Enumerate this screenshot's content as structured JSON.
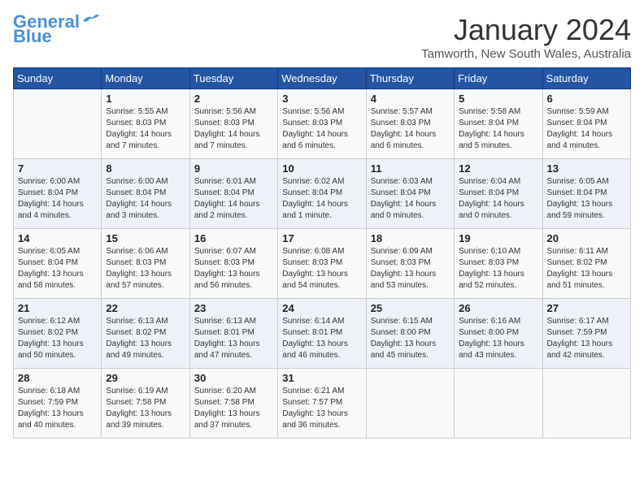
{
  "logo": {
    "line1": "General",
    "line2": "Blue"
  },
  "title": "January 2024",
  "subtitle": "Tamworth, New South Wales, Australia",
  "weekdays": [
    "Sunday",
    "Monday",
    "Tuesday",
    "Wednesday",
    "Thursday",
    "Friday",
    "Saturday"
  ],
  "weeks": [
    [
      {
        "day": "",
        "info": ""
      },
      {
        "day": "1",
        "info": "Sunrise: 5:55 AM\nSunset: 8:03 PM\nDaylight: 14 hours\nand 7 minutes."
      },
      {
        "day": "2",
        "info": "Sunrise: 5:56 AM\nSunset: 8:03 PM\nDaylight: 14 hours\nand 7 minutes."
      },
      {
        "day": "3",
        "info": "Sunrise: 5:56 AM\nSunset: 8:03 PM\nDaylight: 14 hours\nand 6 minutes."
      },
      {
        "day": "4",
        "info": "Sunrise: 5:57 AM\nSunset: 8:03 PM\nDaylight: 14 hours\nand 6 minutes."
      },
      {
        "day": "5",
        "info": "Sunrise: 5:58 AM\nSunset: 8:04 PM\nDaylight: 14 hours\nand 5 minutes."
      },
      {
        "day": "6",
        "info": "Sunrise: 5:59 AM\nSunset: 8:04 PM\nDaylight: 14 hours\nand 4 minutes."
      }
    ],
    [
      {
        "day": "7",
        "info": "Sunrise: 6:00 AM\nSunset: 8:04 PM\nDaylight: 14 hours\nand 4 minutes."
      },
      {
        "day": "8",
        "info": "Sunrise: 6:00 AM\nSunset: 8:04 PM\nDaylight: 14 hours\nand 3 minutes."
      },
      {
        "day": "9",
        "info": "Sunrise: 6:01 AM\nSunset: 8:04 PM\nDaylight: 14 hours\nand 2 minutes."
      },
      {
        "day": "10",
        "info": "Sunrise: 6:02 AM\nSunset: 8:04 PM\nDaylight: 14 hours\nand 1 minute."
      },
      {
        "day": "11",
        "info": "Sunrise: 6:03 AM\nSunset: 8:04 PM\nDaylight: 14 hours\nand 0 minutes."
      },
      {
        "day": "12",
        "info": "Sunrise: 6:04 AM\nSunset: 8:04 PM\nDaylight: 14 hours\nand 0 minutes."
      },
      {
        "day": "13",
        "info": "Sunrise: 6:05 AM\nSunset: 8:04 PM\nDaylight: 13 hours\nand 59 minutes."
      }
    ],
    [
      {
        "day": "14",
        "info": "Sunrise: 6:05 AM\nSunset: 8:04 PM\nDaylight: 13 hours\nand 58 minutes."
      },
      {
        "day": "15",
        "info": "Sunrise: 6:06 AM\nSunset: 8:03 PM\nDaylight: 13 hours\nand 57 minutes."
      },
      {
        "day": "16",
        "info": "Sunrise: 6:07 AM\nSunset: 8:03 PM\nDaylight: 13 hours\nand 56 minutes."
      },
      {
        "day": "17",
        "info": "Sunrise: 6:08 AM\nSunset: 8:03 PM\nDaylight: 13 hours\nand 54 minutes."
      },
      {
        "day": "18",
        "info": "Sunrise: 6:09 AM\nSunset: 8:03 PM\nDaylight: 13 hours\nand 53 minutes."
      },
      {
        "day": "19",
        "info": "Sunrise: 6:10 AM\nSunset: 8:03 PM\nDaylight: 13 hours\nand 52 minutes."
      },
      {
        "day": "20",
        "info": "Sunrise: 6:11 AM\nSunset: 8:02 PM\nDaylight: 13 hours\nand 51 minutes."
      }
    ],
    [
      {
        "day": "21",
        "info": "Sunrise: 6:12 AM\nSunset: 8:02 PM\nDaylight: 13 hours\nand 50 minutes."
      },
      {
        "day": "22",
        "info": "Sunrise: 6:13 AM\nSunset: 8:02 PM\nDaylight: 13 hours\nand 49 minutes."
      },
      {
        "day": "23",
        "info": "Sunrise: 6:13 AM\nSunset: 8:01 PM\nDaylight: 13 hours\nand 47 minutes."
      },
      {
        "day": "24",
        "info": "Sunrise: 6:14 AM\nSunset: 8:01 PM\nDaylight: 13 hours\nand 46 minutes."
      },
      {
        "day": "25",
        "info": "Sunrise: 6:15 AM\nSunset: 8:00 PM\nDaylight: 13 hours\nand 45 minutes."
      },
      {
        "day": "26",
        "info": "Sunrise: 6:16 AM\nSunset: 8:00 PM\nDaylight: 13 hours\nand 43 minutes."
      },
      {
        "day": "27",
        "info": "Sunrise: 6:17 AM\nSunset: 7:59 PM\nDaylight: 13 hours\nand 42 minutes."
      }
    ],
    [
      {
        "day": "28",
        "info": "Sunrise: 6:18 AM\nSunset: 7:59 PM\nDaylight: 13 hours\nand 40 minutes."
      },
      {
        "day": "29",
        "info": "Sunrise: 6:19 AM\nSunset: 7:58 PM\nDaylight: 13 hours\nand 39 minutes."
      },
      {
        "day": "30",
        "info": "Sunrise: 6:20 AM\nSunset: 7:58 PM\nDaylight: 13 hours\nand 37 minutes."
      },
      {
        "day": "31",
        "info": "Sunrise: 6:21 AM\nSunset: 7:57 PM\nDaylight: 13 hours\nand 36 minutes."
      },
      {
        "day": "",
        "info": ""
      },
      {
        "day": "",
        "info": ""
      },
      {
        "day": "",
        "info": ""
      }
    ]
  ]
}
